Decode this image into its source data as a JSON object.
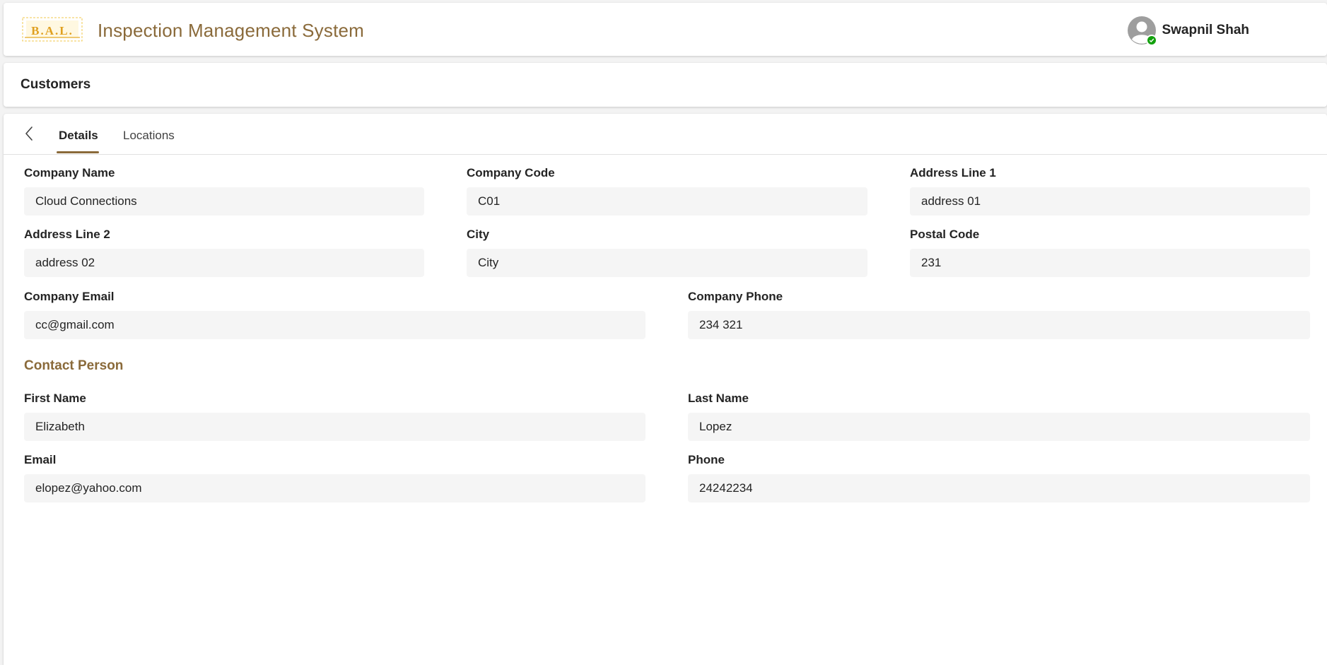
{
  "app": {
    "title": "Inspection Management System",
    "accent_color": "#8a6a3a",
    "logo_icon": "bal-logo-icon"
  },
  "user": {
    "name": "Swapnil Shah",
    "status": "available",
    "status_color": "#13a10e"
  },
  "page": {
    "title": "Customers"
  },
  "tabs": {
    "back_icon": "chevron-left-icon",
    "items": [
      {
        "label": "Details",
        "selected": true
      },
      {
        "label": "Locations",
        "selected": false
      }
    ]
  },
  "form": {
    "company_name": {
      "label": "Company Name",
      "value": "Cloud Connections"
    },
    "company_code": {
      "label": "Company Code",
      "value": "C01"
    },
    "address_line_1": {
      "label": "Address Line 1",
      "value": "address 01"
    },
    "address_line_2": {
      "label": "Address Line 2",
      "value": "address 02"
    },
    "city": {
      "label": "City",
      "value": "City"
    },
    "postal_code": {
      "label": "Postal Code",
      "value": "231"
    },
    "company_email": {
      "label": "Company Email",
      "value": "cc@gmail.com"
    },
    "company_phone": {
      "label": "Company Phone",
      "value": "234 321"
    }
  },
  "contact": {
    "section_title": "Contact Person",
    "first_name": {
      "label": "First Name",
      "value": "Elizabeth"
    },
    "last_name": {
      "label": "Last Name",
      "value": "Lopez"
    },
    "email": {
      "label": "Email",
      "value": "elopez@yahoo.com"
    },
    "phone": {
      "label": "Phone",
      "value": "24242234"
    }
  }
}
